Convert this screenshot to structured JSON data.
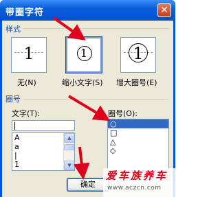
{
  "window": {
    "title": "带圈字符",
    "close_glyph": "✕"
  },
  "style_section": {
    "label": "样式",
    "options": [
      {
        "label": "无(N)",
        "glyph": "1",
        "style": "none"
      },
      {
        "label": "缩小文字(S)",
        "glyph": "1",
        "style": "shrink",
        "selected": true
      },
      {
        "label": "增大圈号(E)",
        "glyph": "1",
        "style": "enlarge"
      }
    ]
  },
  "enclosure_section": {
    "label": "圈号",
    "text_label": "文字(T):",
    "text_value": "",
    "text_items": [
      "A",
      "a",
      "|",
      "1"
    ],
    "symbol_label": "圈号(O):",
    "symbol_items": [
      "○",
      "□",
      "△",
      "◇"
    ],
    "symbol_selected_index": 0
  },
  "buttons": {
    "ok": "确定"
  },
  "watermark": {
    "brand": "爱车族养车",
    "url": "www.aczcn.com"
  },
  "colors": {
    "title_bar": "#0054e3",
    "section_label": "#0046d5",
    "selection": "#316ac5",
    "arrow": "#e0001b",
    "watermark": "#e0001b"
  }
}
